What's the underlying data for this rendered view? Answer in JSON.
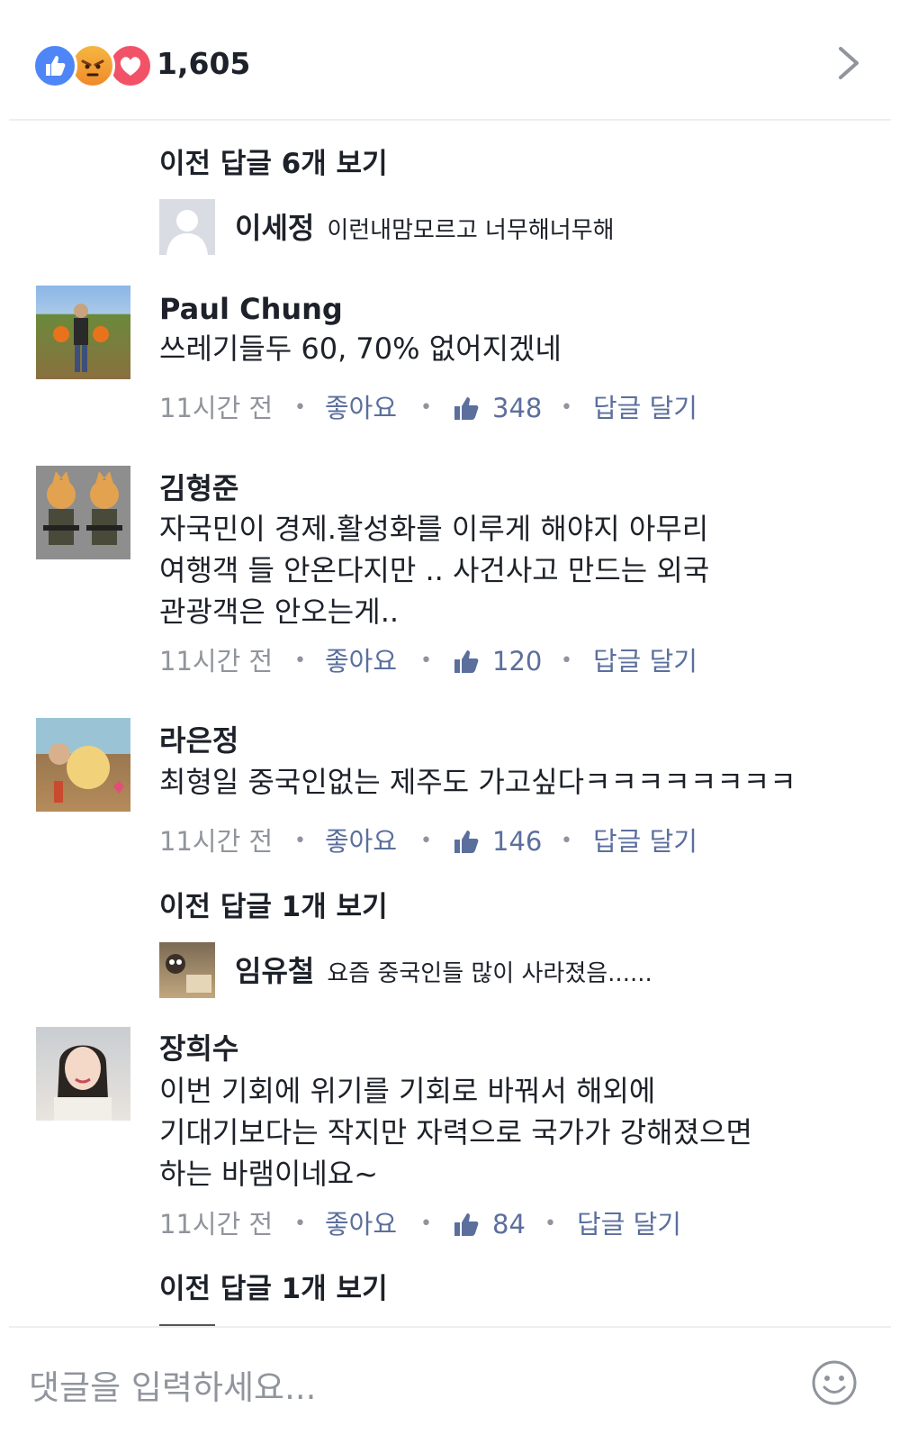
{
  "header": {
    "reactions": [
      "like-icon",
      "angry-icon",
      "love-icon"
    ],
    "count": "1,605"
  },
  "threads": [
    {
      "view_prev": "이전 답글 6개 보기",
      "reply": {
        "name": "이세정",
        "text": "이런내맘모르고 너무해너무해"
      }
    }
  ],
  "comments": [
    {
      "name": "Paul Chung",
      "lines": [
        "쓰레기들두 60, 70% 없어지겠네"
      ],
      "time": "11시간 전",
      "like_label": "좋아요",
      "likes": "348",
      "reply_label": "답글 달기"
    },
    {
      "name": "김형준",
      "lines": [
        "자국민이 경제.활성화를 이루게 해야지   아무리",
        "여행객 들  안온다지만  .. 사건사고 만드는 외국",
        "관광객은  안오는게.."
      ],
      "time": "11시간 전",
      "like_label": "좋아요",
      "likes": "120",
      "reply_label": "답글 달기"
    },
    {
      "name": "라은정",
      "lines": [
        "최형일 중국인없는 제주도 가고싶다ㅋㅋㅋㅋㅋㅋㅋㅋ"
      ],
      "time": "11시간 전",
      "like_label": "좋아요",
      "likes": "146",
      "reply_label": "답글 달기",
      "view_prev": "이전 답글 1개 보기",
      "reply": {
        "name": "임유철",
        "text": "요즘 중국인들 많이 사라졌음......"
      }
    },
    {
      "name": "장희수",
      "lines": [
        "이번 기회에 위기를 기회로 바꿔서 해외에",
        "기대기보다는 작지만 자력으로 국가가 강해졌으면",
        "하는 바램이네요~"
      ],
      "time": "11시간 전",
      "like_label": "좋아요",
      "likes": "84",
      "reply_label": "답글 달기",
      "view_prev": "이전 답글 1개 보기"
    }
  ],
  "composer": {
    "placeholder": "댓글을 입력하세요..."
  },
  "colors": {
    "link": "#5b6f9d",
    "muted": "#90949c",
    "text": "#1d2129",
    "like_blue": "#4e86f7",
    "love_red": "#f25268"
  }
}
